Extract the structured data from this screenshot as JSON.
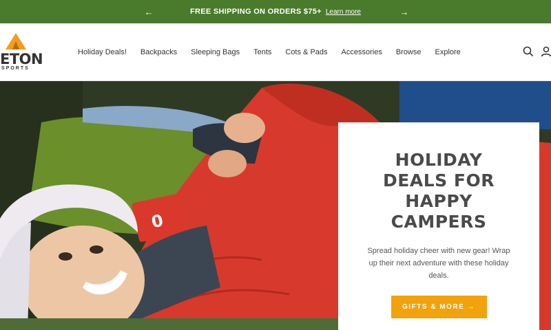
{
  "announcement": {
    "message": "FREE SHIPPING ON ORDERS $75+",
    "link": "Learn more",
    "prev_glyph": "←",
    "next_glyph": "→"
  },
  "brand": {
    "wordmark": "ETON",
    "subword": "SPORTS",
    "accent": "#f39c1e"
  },
  "nav": {
    "items": [
      "Holiday Deals!",
      "Backpacks",
      "Sleeping Bags",
      "Tents",
      "Cots & Pads",
      "Accessories",
      "Browse",
      "Explore"
    ]
  },
  "header_icons": [
    "search-icon",
    "account-icon"
  ],
  "hero": {
    "title": "HOLIDAY DEALS FOR HAPPY CAMPERS",
    "description": "Spread holiday cheer with new gear! Wrap up their next adventure with these holiday deals.",
    "cta": "GIFTS & MORE →",
    "tag_text": "0",
    "cta_color": "#f2a20c",
    "bar_color": "#4a7a2c"
  }
}
